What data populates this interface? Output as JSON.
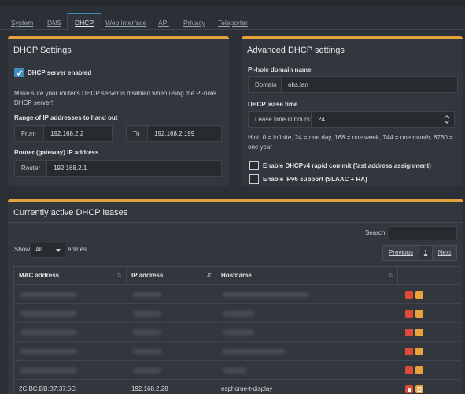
{
  "tabs": [
    "System",
    "DNS",
    "DHCP",
    "Web interface",
    "API",
    "Privacy",
    "Teleporter"
  ],
  "dhcp": {
    "title": "DHCP Settings",
    "server_enabled": "DHCP server enabled",
    "note": "Make sure your router's DHCP server is disabled when using the Pi-hole DHCP server!",
    "range_label": "Range of IP addresses to hand out",
    "from_label": "From",
    "from_value": "192.168.2.2",
    "to_label": "To",
    "to_value": "192.168.2.199",
    "router_label": "Router (gateway) IP address",
    "router_addon": "Router",
    "router_value": "192.168.2.1"
  },
  "advanced": {
    "title": "Advanced DHCP settings",
    "domain_label": "Pi-hole domain name",
    "domain_addon": "Domain",
    "domain_value": "ohs.lan",
    "lease_label": "DHCP lease time",
    "lease_addon": "Lease time in hours",
    "lease_value": "24",
    "hint": "Hint: 0 = infinite, 24 = one day, 168 = one week, 744 = one month, 8760 = one year",
    "rapid_commit": "Enable DHCPv4 rapid commit (fast address assignment)",
    "ipv6": "Enable IPv6 support (SLAAC + RA)"
  },
  "leases": {
    "title": "Currently active DHCP leases",
    "search_label": "Search:",
    "show_label": "Show",
    "show_value": "All",
    "entries_label": "entries",
    "previous": "Previous",
    "page": "1",
    "next": "Next",
    "columns": [
      "MAC address",
      "IP address",
      "Hostname"
    ],
    "visible_row": {
      "mac": "2C:BC:BB:B7:37:5C",
      "ip": "192.168.2.28",
      "host": "esphome-t-display"
    }
  },
  "colors": {
    "accent": "#e4a33a",
    "primary": "#3c8dbc",
    "delete": "#dd4b39",
    "edit": "#e8a33b"
  }
}
